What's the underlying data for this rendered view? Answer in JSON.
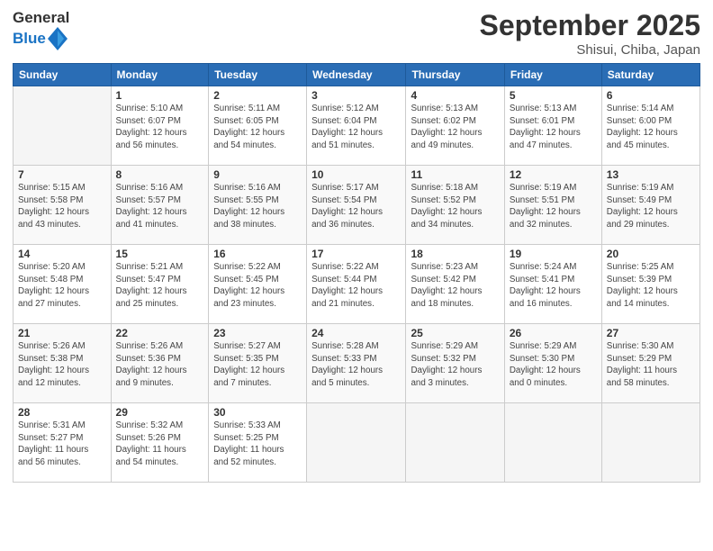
{
  "header": {
    "logo_line1": "General",
    "logo_line2": "Blue",
    "month": "September 2025",
    "location": "Shisui, Chiba, Japan"
  },
  "days_of_week": [
    "Sunday",
    "Monday",
    "Tuesday",
    "Wednesday",
    "Thursday",
    "Friday",
    "Saturday"
  ],
  "weeks": [
    [
      {
        "day": "",
        "info": ""
      },
      {
        "day": "1",
        "info": "Sunrise: 5:10 AM\nSunset: 6:07 PM\nDaylight: 12 hours\nand 56 minutes."
      },
      {
        "day": "2",
        "info": "Sunrise: 5:11 AM\nSunset: 6:05 PM\nDaylight: 12 hours\nand 54 minutes."
      },
      {
        "day": "3",
        "info": "Sunrise: 5:12 AM\nSunset: 6:04 PM\nDaylight: 12 hours\nand 51 minutes."
      },
      {
        "day": "4",
        "info": "Sunrise: 5:13 AM\nSunset: 6:02 PM\nDaylight: 12 hours\nand 49 minutes."
      },
      {
        "day": "5",
        "info": "Sunrise: 5:13 AM\nSunset: 6:01 PM\nDaylight: 12 hours\nand 47 minutes."
      },
      {
        "day": "6",
        "info": "Sunrise: 5:14 AM\nSunset: 6:00 PM\nDaylight: 12 hours\nand 45 minutes."
      }
    ],
    [
      {
        "day": "7",
        "info": "Sunrise: 5:15 AM\nSunset: 5:58 PM\nDaylight: 12 hours\nand 43 minutes."
      },
      {
        "day": "8",
        "info": "Sunrise: 5:16 AM\nSunset: 5:57 PM\nDaylight: 12 hours\nand 41 minutes."
      },
      {
        "day": "9",
        "info": "Sunrise: 5:16 AM\nSunset: 5:55 PM\nDaylight: 12 hours\nand 38 minutes."
      },
      {
        "day": "10",
        "info": "Sunrise: 5:17 AM\nSunset: 5:54 PM\nDaylight: 12 hours\nand 36 minutes."
      },
      {
        "day": "11",
        "info": "Sunrise: 5:18 AM\nSunset: 5:52 PM\nDaylight: 12 hours\nand 34 minutes."
      },
      {
        "day": "12",
        "info": "Sunrise: 5:19 AM\nSunset: 5:51 PM\nDaylight: 12 hours\nand 32 minutes."
      },
      {
        "day": "13",
        "info": "Sunrise: 5:19 AM\nSunset: 5:49 PM\nDaylight: 12 hours\nand 29 minutes."
      }
    ],
    [
      {
        "day": "14",
        "info": "Sunrise: 5:20 AM\nSunset: 5:48 PM\nDaylight: 12 hours\nand 27 minutes."
      },
      {
        "day": "15",
        "info": "Sunrise: 5:21 AM\nSunset: 5:47 PM\nDaylight: 12 hours\nand 25 minutes."
      },
      {
        "day": "16",
        "info": "Sunrise: 5:22 AM\nSunset: 5:45 PM\nDaylight: 12 hours\nand 23 minutes."
      },
      {
        "day": "17",
        "info": "Sunrise: 5:22 AM\nSunset: 5:44 PM\nDaylight: 12 hours\nand 21 minutes."
      },
      {
        "day": "18",
        "info": "Sunrise: 5:23 AM\nSunset: 5:42 PM\nDaylight: 12 hours\nand 18 minutes."
      },
      {
        "day": "19",
        "info": "Sunrise: 5:24 AM\nSunset: 5:41 PM\nDaylight: 12 hours\nand 16 minutes."
      },
      {
        "day": "20",
        "info": "Sunrise: 5:25 AM\nSunset: 5:39 PM\nDaylight: 12 hours\nand 14 minutes."
      }
    ],
    [
      {
        "day": "21",
        "info": "Sunrise: 5:26 AM\nSunset: 5:38 PM\nDaylight: 12 hours\nand 12 minutes."
      },
      {
        "day": "22",
        "info": "Sunrise: 5:26 AM\nSunset: 5:36 PM\nDaylight: 12 hours\nand 9 minutes."
      },
      {
        "day": "23",
        "info": "Sunrise: 5:27 AM\nSunset: 5:35 PM\nDaylight: 12 hours\nand 7 minutes."
      },
      {
        "day": "24",
        "info": "Sunrise: 5:28 AM\nSunset: 5:33 PM\nDaylight: 12 hours\nand 5 minutes."
      },
      {
        "day": "25",
        "info": "Sunrise: 5:29 AM\nSunset: 5:32 PM\nDaylight: 12 hours\nand 3 minutes."
      },
      {
        "day": "26",
        "info": "Sunrise: 5:29 AM\nSunset: 5:30 PM\nDaylight: 12 hours\nand 0 minutes."
      },
      {
        "day": "27",
        "info": "Sunrise: 5:30 AM\nSunset: 5:29 PM\nDaylight: 11 hours\nand 58 minutes."
      }
    ],
    [
      {
        "day": "28",
        "info": "Sunrise: 5:31 AM\nSunset: 5:27 PM\nDaylight: 11 hours\nand 56 minutes."
      },
      {
        "day": "29",
        "info": "Sunrise: 5:32 AM\nSunset: 5:26 PM\nDaylight: 11 hours\nand 54 minutes."
      },
      {
        "day": "30",
        "info": "Sunrise: 5:33 AM\nSunset: 5:25 PM\nDaylight: 11 hours\nand 52 minutes."
      },
      {
        "day": "",
        "info": ""
      },
      {
        "day": "",
        "info": ""
      },
      {
        "day": "",
        "info": ""
      },
      {
        "day": "",
        "info": ""
      }
    ]
  ]
}
